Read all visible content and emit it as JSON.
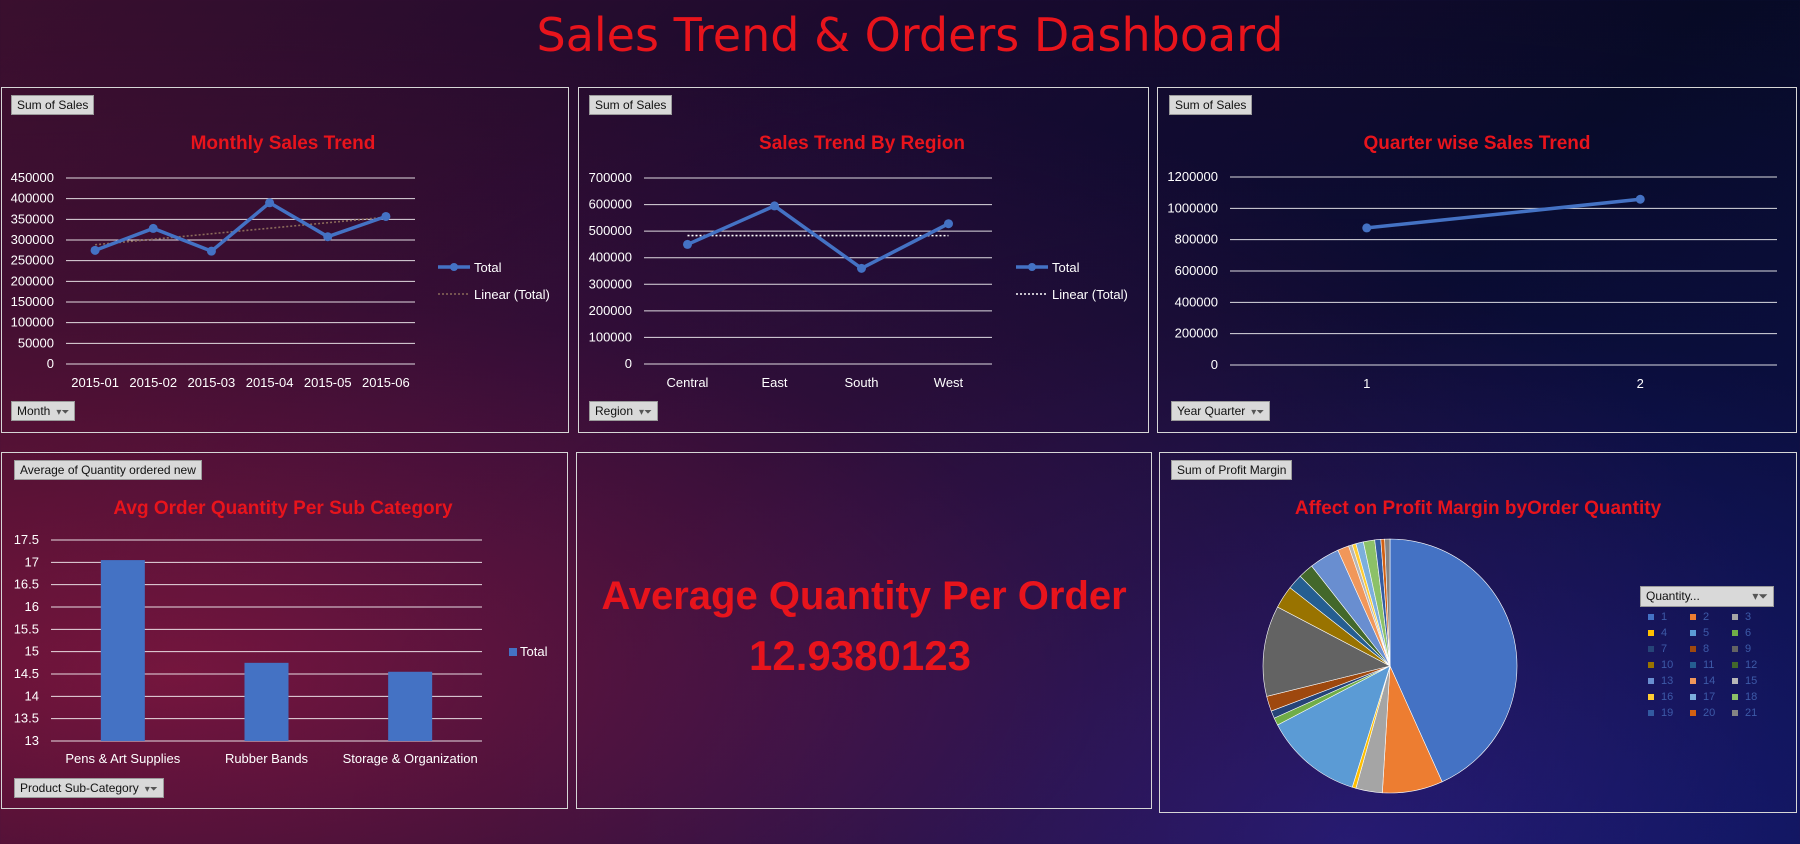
{
  "dashboard": {
    "title": "Sales Trend & Orders Dashboard"
  },
  "colors": {
    "accent": "#e8141c",
    "series": "#4472c4",
    "trend_brown": "#8a6a5a",
    "trend_white": "#ffffff",
    "grid": "#ffffff"
  },
  "panels": {
    "monthly": {
      "field_button": "Sum of Sales",
      "axis_button": "Month",
      "legend_total": "Total",
      "legend_linear": "Linear (Total)"
    },
    "region": {
      "field_button": "Sum of Sales",
      "axis_button": "Region",
      "legend_total": "Total",
      "legend_linear": "Linear (Total)"
    },
    "quarter": {
      "field_button": "Sum of Sales",
      "axis_button": "Year Quarter"
    },
    "subcat": {
      "field_button": "Average of Quantity ordered new",
      "axis_button": "Product Sub-Category",
      "legend_total": "Total"
    },
    "kpi": {
      "label": "Average Quantity Per Order",
      "value": "12.9380123"
    },
    "profit": {
      "field_button": "Sum of Profit Margin",
      "legend_header": "Quantity..."
    }
  },
  "chart_data": [
    {
      "id": "monthly",
      "type": "line",
      "title": "Monthly Sales Trend",
      "categories": [
        "2015-01",
        "2015-02",
        "2015-03",
        "2015-04",
        "2015-05",
        "2015-06"
      ],
      "series": [
        {
          "name": "Total",
          "values": [
            275000,
            328000,
            273000,
            390000,
            308000,
            357000
          ]
        }
      ],
      "trendline": "Linear (Total)",
      "yticks": [
        "0",
        "50000",
        "100000",
        "150000",
        "200000",
        "250000",
        "300000",
        "350000",
        "400000",
        "450000"
      ],
      "ylim": [
        0,
        450000
      ]
    },
    {
      "id": "region",
      "type": "line",
      "title": "Sales Trend By Region",
      "categories": [
        "Central",
        "East",
        "South",
        "West"
      ],
      "series": [
        {
          "name": "Total",
          "values": [
            450000,
            595000,
            360000,
            528000
          ]
        }
      ],
      "trendline": "Linear (Total)",
      "yticks": [
        "0",
        "100000",
        "200000",
        "300000",
        "400000",
        "500000",
        "600000",
        "700000"
      ],
      "ylim": [
        0,
        700000
      ]
    },
    {
      "id": "quarter",
      "type": "line",
      "title": "Quarter wise Sales Trend",
      "categories": [
        "1",
        "2"
      ],
      "series": [
        {
          "name": "Total",
          "values": [
            875000,
            1058000
          ]
        }
      ],
      "yticks": [
        "0",
        "200000",
        "400000",
        "600000",
        "800000",
        "1000000",
        "1200000"
      ],
      "ylim": [
        0,
        1200000
      ]
    },
    {
      "id": "subcat",
      "type": "bar",
      "title": "Avg Order Quantity Per Sub Category",
      "categories": [
        "Pens & Art Supplies",
        "Rubber Bands",
        "Storage & Organization"
      ],
      "series": [
        {
          "name": "Total",
          "values": [
            17.05,
            14.75,
            14.55
          ]
        }
      ],
      "yticks": [
        "13",
        "13.5",
        "14",
        "14.5",
        "15",
        "15.5",
        "16",
        "16.5",
        "17",
        "17.5"
      ],
      "ylim": [
        13,
        17.5
      ]
    },
    {
      "id": "profit",
      "type": "pie",
      "title": "Affect on Profit Margin byOrder Quantity",
      "legend_title": "Quantity...",
      "labels": [
        "1",
        "2",
        "3",
        "4",
        "5",
        "6",
        "7",
        "8",
        "9",
        "10",
        "11",
        "12",
        "13",
        "14",
        "15",
        "16",
        "17",
        "18",
        "19",
        "20",
        "21"
      ],
      "values": [
        45,
        8,
        3.5,
        0.5,
        13,
        1,
        1,
        2,
        12,
        3,
        2,
        2,
        4,
        1.5,
        0.5,
        0.5,
        1,
        1.5,
        0.8,
        0.5,
        0.7
      ],
      "colors": [
        "#4472c4",
        "#ed7d31",
        "#a5a5a5",
        "#ffc000",
        "#5b9bd5",
        "#70ad47",
        "#264478",
        "#9e480e",
        "#636363",
        "#997300",
        "#255e91",
        "#43682b",
        "#698ed0",
        "#f1975a",
        "#b7b7b7",
        "#ffcd33",
        "#7cafdd",
        "#8cc168",
        "#335aa1",
        "#d26012",
        "#848484"
      ]
    }
  ]
}
